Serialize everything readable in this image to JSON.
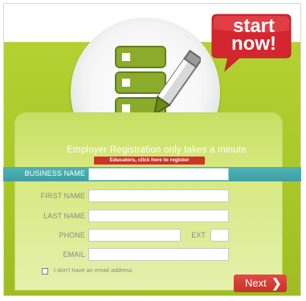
{
  "badge": {
    "line1": "start",
    "line2": "now!"
  },
  "header": {
    "headline": "Employer Registration only takes a minute",
    "educators_link": "Educators, click here to register"
  },
  "form": {
    "business_name": {
      "label": "BUSINESS NAME",
      "value": ""
    },
    "first_name": {
      "label": "FIRST NAME",
      "value": ""
    },
    "last_name": {
      "label": "LAST NAME",
      "value": ""
    },
    "phone": {
      "label": "PHONE",
      "value": ""
    },
    "ext": {
      "label": "EXT",
      "value": ""
    },
    "email": {
      "label": "EMAIL",
      "value": ""
    },
    "no_email": {
      "label": "I don't have an email address",
      "checked": false
    }
  },
  "actions": {
    "next_label": "Next"
  },
  "colors": {
    "brand_green": "#a9c628",
    "accent_teal": "#3ea0a3",
    "cta_red": "#c9312a"
  },
  "icons": [
    "server-stack-icon",
    "pencil-icon",
    "chevron-right-icon"
  ]
}
